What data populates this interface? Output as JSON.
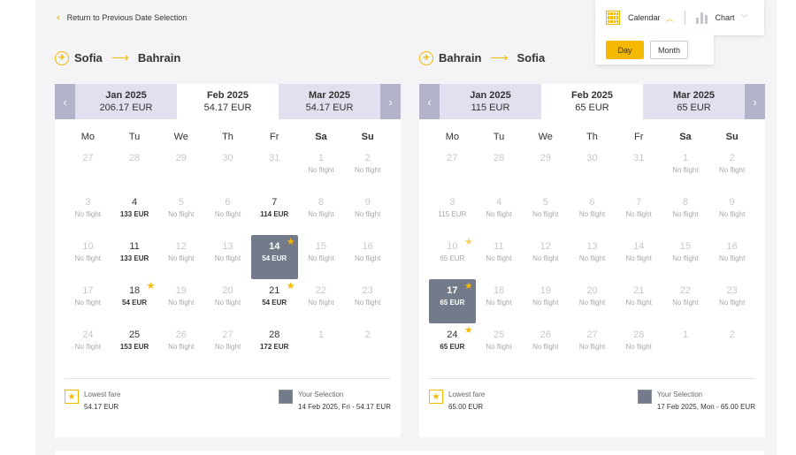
{
  "back_link": "Return to Previous Date Selection",
  "toolbar": {
    "calendar_label": "Calendar",
    "calendar_icon": "calendar-grid-icon",
    "chart_label": "Chart",
    "chart_icon": "bar-chart-icon",
    "day_label": "Day",
    "month_label": "Month",
    "accent": "#f5b800"
  },
  "weekdays": [
    "Mo",
    "Tu",
    "We",
    "Th",
    "Fr",
    "Sa",
    "Su"
  ],
  "calendars": [
    {
      "origin": "Sofia",
      "destination": "Bahrain",
      "months": [
        {
          "name": "Jan 2025",
          "price": "206.17 EUR"
        },
        {
          "name": "Feb 2025",
          "price": "54.17 EUR",
          "active": true
        },
        {
          "name": "Mar 2025",
          "price": "54.17 EUR"
        }
      ],
      "days": [
        {
          "d": "27",
          "p": "",
          "dis": true
        },
        {
          "d": "28",
          "p": "",
          "dis": true
        },
        {
          "d": "29",
          "p": "",
          "dis": true
        },
        {
          "d": "30",
          "p": "",
          "dis": true
        },
        {
          "d": "31",
          "p": "",
          "dis": true
        },
        {
          "d": "1",
          "p": "No flight",
          "dis": true
        },
        {
          "d": "2",
          "p": "No flight",
          "dis": true
        },
        {
          "d": "3",
          "p": "No flight",
          "dis": true
        },
        {
          "d": "4",
          "p": "133 EUR"
        },
        {
          "d": "5",
          "p": "No flight",
          "dis": true
        },
        {
          "d": "6",
          "p": "No flight",
          "dis": true
        },
        {
          "d": "7",
          "p": "114 EUR"
        },
        {
          "d": "8",
          "p": "No flight",
          "dis": true
        },
        {
          "d": "9",
          "p": "No flight",
          "dis": true
        },
        {
          "d": "10",
          "p": "No flight",
          "dis": true
        },
        {
          "d": "11",
          "p": "133 EUR"
        },
        {
          "d": "12",
          "p": "No flight",
          "dis": true
        },
        {
          "d": "13",
          "p": "No flight",
          "dis": true
        },
        {
          "d": "14",
          "p": "54 EUR",
          "sel": true,
          "star": true
        },
        {
          "d": "15",
          "p": "No flight",
          "dis": true
        },
        {
          "d": "16",
          "p": "No flight",
          "dis": true
        },
        {
          "d": "17",
          "p": "No flight",
          "dis": true
        },
        {
          "d": "18",
          "p": "54 EUR",
          "star": true
        },
        {
          "d": "19",
          "p": "No flight",
          "dis": true
        },
        {
          "d": "20",
          "p": "No flight",
          "dis": true
        },
        {
          "d": "21",
          "p": "54 EUR",
          "star": true
        },
        {
          "d": "22",
          "p": "No flight",
          "dis": true
        },
        {
          "d": "23",
          "p": "No flight",
          "dis": true
        },
        {
          "d": "24",
          "p": "No flight",
          "dis": true
        },
        {
          "d": "25",
          "p": "153 EUR"
        },
        {
          "d": "26",
          "p": "No flight",
          "dis": true
        },
        {
          "d": "27",
          "p": "No flight",
          "dis": true
        },
        {
          "d": "28",
          "p": "172 EUR"
        },
        {
          "d": "1",
          "p": "",
          "dis": true
        },
        {
          "d": "2",
          "p": "",
          "dis": true
        }
      ],
      "legend": {
        "lowest_label": "Lowest fare",
        "lowest_value": "54.17 EUR",
        "selection_label": "Your Selection",
        "selection_value": "14 Feb 2025, Fri - 54.17 EUR"
      }
    },
    {
      "origin": "Bahrain",
      "destination": "Sofia",
      "months": [
        {
          "name": "Jan 2025",
          "price": "115 EUR"
        },
        {
          "name": "Feb 2025",
          "price": "65 EUR",
          "active": true
        },
        {
          "name": "Mar 2025",
          "price": "65 EUR"
        }
      ],
      "days": [
        {
          "d": "27",
          "p": "",
          "dis": true
        },
        {
          "d": "28",
          "p": "",
          "dis": true
        },
        {
          "d": "29",
          "p": "",
          "dis": true
        },
        {
          "d": "30",
          "p": "",
          "dis": true
        },
        {
          "d": "31",
          "p": "",
          "dis": true
        },
        {
          "d": "1",
          "p": "No flight",
          "dis": true
        },
        {
          "d": "2",
          "p": "No flight",
          "dis": true
        },
        {
          "d": "3",
          "p": "115 EUR",
          "dis": true
        },
        {
          "d": "4",
          "p": "No flight",
          "dis": true
        },
        {
          "d": "5",
          "p": "No flight",
          "dis": true
        },
        {
          "d": "6",
          "p": "No flight",
          "dis": true
        },
        {
          "d": "7",
          "p": "No flight",
          "dis": true
        },
        {
          "d": "8",
          "p": "No flight",
          "dis": true
        },
        {
          "d": "9",
          "p": "No flight",
          "dis": true
        },
        {
          "d": "10",
          "p": "65 EUR",
          "dis": true,
          "star": true
        },
        {
          "d": "11",
          "p": "No flight",
          "dis": true
        },
        {
          "d": "12",
          "p": "No flight",
          "dis": true
        },
        {
          "d": "13",
          "p": "No flight",
          "dis": true
        },
        {
          "d": "14",
          "p": "No flight",
          "dis": true
        },
        {
          "d": "15",
          "p": "No flight",
          "dis": true
        },
        {
          "d": "16",
          "p": "No flight",
          "dis": true
        },
        {
          "d": "17",
          "p": "65 EUR",
          "sel": true,
          "star": true
        },
        {
          "d": "18",
          "p": "No flight",
          "dis": true
        },
        {
          "d": "19",
          "p": "No flight",
          "dis": true
        },
        {
          "d": "20",
          "p": "No flight",
          "dis": true
        },
        {
          "d": "21",
          "p": "No flight",
          "dis": true
        },
        {
          "d": "22",
          "p": "No flight",
          "dis": true
        },
        {
          "d": "23",
          "p": "No flight",
          "dis": true
        },
        {
          "d": "24",
          "p": "65 EUR",
          "star": true
        },
        {
          "d": "25",
          "p": "No flight",
          "dis": true
        },
        {
          "d": "26",
          "p": "No flight",
          "dis": true
        },
        {
          "d": "27",
          "p": "No flight",
          "dis": true
        },
        {
          "d": "28",
          "p": "No flight",
          "dis": true
        },
        {
          "d": "1",
          "p": "",
          "dis": true
        },
        {
          "d": "2",
          "p": "",
          "dis": true
        }
      ],
      "legend": {
        "lowest_label": "Lowest fare",
        "lowest_value": "65.00 EUR",
        "selection_label": "Your Selection",
        "selection_value": "17 Feb 2025, Mon - 65.00 EUR"
      }
    }
  ]
}
